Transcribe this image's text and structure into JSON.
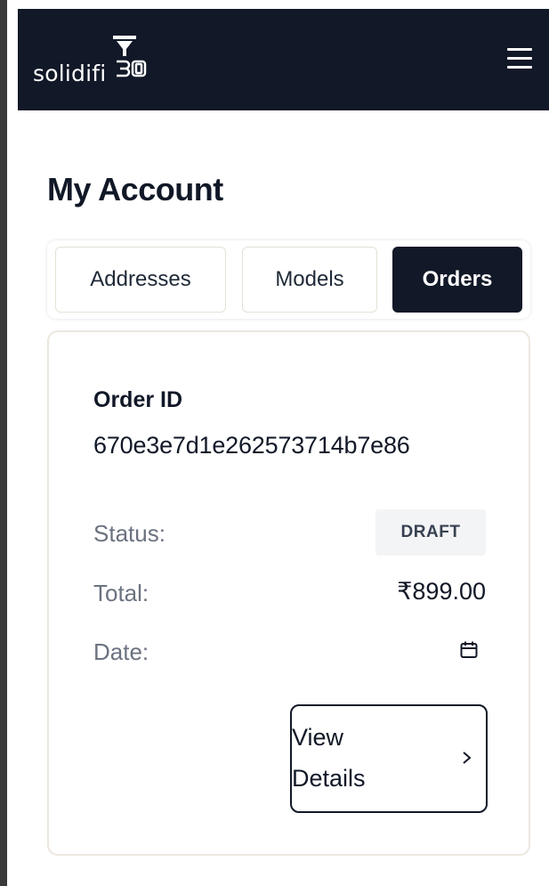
{
  "header": {
    "logo_text": "solidifi",
    "logo_suffix": "3D"
  },
  "page": {
    "title": "My Account"
  },
  "tabs": [
    {
      "label": "Addresses",
      "active": false
    },
    {
      "label": "Models",
      "active": false
    },
    {
      "label": "Orders",
      "active": true
    }
  ],
  "order": {
    "id_label": "Order ID",
    "id_value": "670e3e7d1e262573714b7e86",
    "status_label": "Status:",
    "status_value": "DRAFT",
    "total_label": "Total:",
    "total_value": "₹899.00",
    "date_label": "Date:",
    "view_button_line1": "View",
    "view_button_line2": "Details"
  },
  "icons": {
    "menu": "hamburger-menu-icon",
    "calendar": "calendar-icon",
    "chevron": "chevron-right-icon"
  },
  "colors": {
    "navbar_bg": "#111827",
    "active_tab_bg": "#111827",
    "badge_bg": "#f3f4f6",
    "muted_text": "#6b7280"
  }
}
